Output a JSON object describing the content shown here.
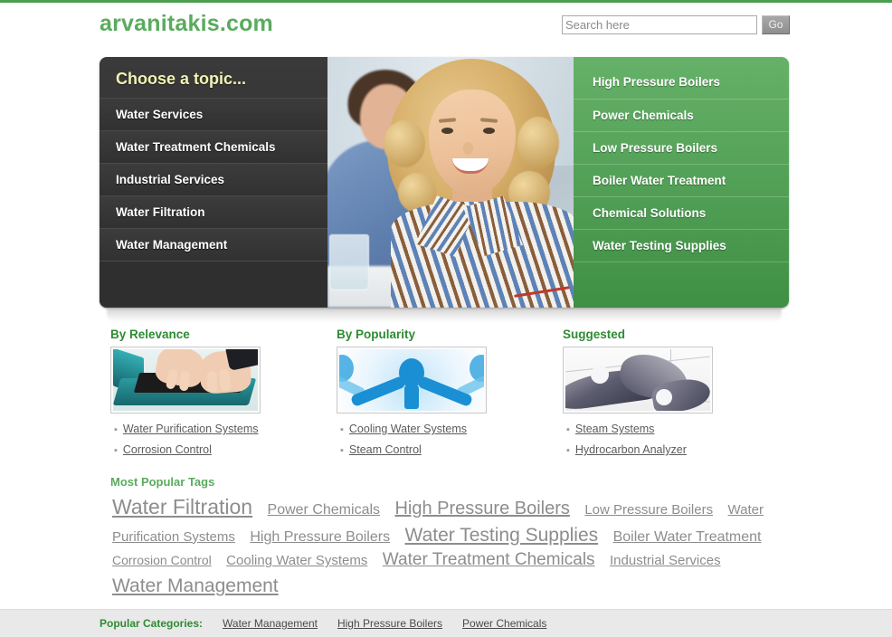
{
  "site": {
    "logo": "arvanitakis.com",
    "accent_green": "#5aab5e",
    "dark_panel": "#3a3a3a",
    "top_rule_color": "#4c9e4f"
  },
  "search": {
    "placeholder": "Search here",
    "value": "",
    "button_label": "Go"
  },
  "menu_left": {
    "title": "Choose a topic...",
    "items": [
      {
        "label": "Water Services"
      },
      {
        "label": "Water Treatment Chemicals"
      },
      {
        "label": "Industrial Services"
      },
      {
        "label": "Water Filtration"
      },
      {
        "label": "Water Management"
      }
    ]
  },
  "menu_right": {
    "items": [
      {
        "label": "High Pressure Boilers"
      },
      {
        "label": "Power Chemicals"
      },
      {
        "label": "Low Pressure Boilers"
      },
      {
        "label": "Boiler Water Treatment"
      },
      {
        "label": "Chemical Solutions"
      },
      {
        "label": "Water Testing Supplies"
      }
    ]
  },
  "hero_photo": {
    "alt": "smiling woman with curly blonde hair in striped shirt, man in blue shirt behind"
  },
  "columns": [
    {
      "title": "By Relevance",
      "image_alt": "hands typing on a teal laptop keyboard",
      "links": [
        "Water Purification Systems",
        "Corrosion Control"
      ]
    },
    {
      "title": "By Popularity",
      "image_alt": "blue stylized figure network icon",
      "links": [
        "Cooling Water Systems",
        "Steam Control"
      ]
    },
    {
      "title": "Suggested",
      "image_alt": "grayscale interlocking puzzle pieces",
      "links": [
        "Steam Systems",
        "Hydrocarbon Analyzer"
      ]
    }
  ],
  "tags": {
    "title": "Most Popular Tags",
    "items": [
      {
        "label": "Water Filtration",
        "size": 23
      },
      {
        "label": "Power Chemicals",
        "size": 16
      },
      {
        "label": "High Pressure Boilers",
        "size": 20
      },
      {
        "label": "Low Pressure Boilers",
        "size": 15
      },
      {
        "label": "Water",
        "size": 15
      },
      {
        "label": "Purification Systems",
        "size": 15
      },
      {
        "label": "High Pressure Boilers",
        "size": 16
      },
      {
        "label": "Water Testing Supplies",
        "size": 21
      },
      {
        "label": "Boiler Water Treatment",
        "size": 16
      },
      {
        "label": "Corrosion Control",
        "size": 14
      },
      {
        "label": "Cooling Water Systems",
        "size": 15
      },
      {
        "label": "Water Treatment Chemicals",
        "size": 19
      },
      {
        "label": "Industrial Services",
        "size": 15
      },
      {
        "label": "Water Management",
        "size": 21
      }
    ]
  },
  "footer": {
    "label": "Popular Categories:",
    "links": [
      "Water Management",
      "High Pressure Boilers",
      "Power Chemicals"
    ]
  }
}
